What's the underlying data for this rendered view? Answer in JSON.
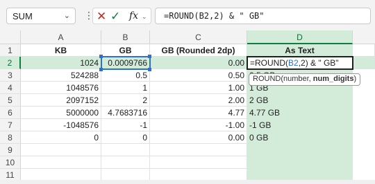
{
  "formula_bar": {
    "name_box": "SUM",
    "name_box_chevron": "⌄",
    "separator": "⋮",
    "cancel_icon": "✕",
    "enter_icon": "✓",
    "fx_label": "fx",
    "fx_chevron": "⌄",
    "formula": "=ROUND(B2,2) & \" GB\""
  },
  "columns": [
    "A",
    "B",
    "C",
    "D"
  ],
  "rows": [
    "1",
    "2",
    "3",
    "4",
    "5",
    "6",
    "7",
    "8",
    "9",
    "10",
    "11"
  ],
  "headers": {
    "a": "KB",
    "b": "GB",
    "c": "GB (Rounded 2dp)",
    "d": "As Text"
  },
  "data": [
    {
      "a": "1024",
      "b": "0.0009766",
      "c": "0.00",
      "d": ""
    },
    {
      "a": "524288",
      "b": "0.5",
      "c": "0.50",
      "d": "0.5 GB"
    },
    {
      "a": "1048576",
      "b": "1",
      "c": "1.00",
      "d": "1 GB"
    },
    {
      "a": "2097152",
      "b": "2",
      "c": "2.00",
      "d": "2 GB"
    },
    {
      "a": "5000000",
      "b": "4.7683716",
      "c": "4.77",
      "d": "4.77 GB"
    },
    {
      "a": "-1048576",
      "b": "-1",
      "c": "-1.00",
      "d": "-1 GB"
    },
    {
      "a": "0",
      "b": "0",
      "c": "0.00",
      "d": "0 GB"
    }
  ],
  "editing_cell": {
    "prefix": "=ROUND(",
    "ref": "B2",
    "suffix": ",2) & \" GB\""
  },
  "tooltip": {
    "function": "ROUND(number, ",
    "current_arg": "num_digits",
    "close": ")"
  }
}
